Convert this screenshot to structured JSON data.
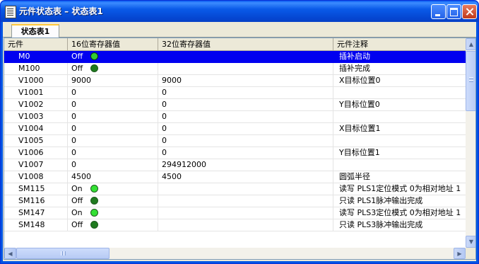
{
  "window": {
    "title": "元件状态表 – 状态表1",
    "buttons": {
      "minimize": "minimize",
      "maximize": "maximize",
      "close": "close"
    }
  },
  "tabs": [
    {
      "label": "状态表1",
      "active": true
    }
  ],
  "table": {
    "columns": [
      "元件",
      "16位寄存器值",
      "32位寄存器值",
      "元件注释"
    ],
    "rows": [
      {
        "name": "M0",
        "v16": "Off",
        "led": "on",
        "v32": "",
        "note": "插补启动",
        "selected": true
      },
      {
        "name": "M100",
        "v16": "Off",
        "led": "off",
        "v32": "",
        "note": "插补完成"
      },
      {
        "name": "V1000",
        "v16": "9000",
        "v32": "9000",
        "note": "X目标位置0"
      },
      {
        "name": "V1001",
        "v16": "0",
        "v32": "0",
        "note": ""
      },
      {
        "name": "V1002",
        "v16": "0",
        "v32": "0",
        "note": "Y目标位置0"
      },
      {
        "name": "V1003",
        "v16": "0",
        "v32": "0",
        "note": ""
      },
      {
        "name": "V1004",
        "v16": "0",
        "v32": "0",
        "note": "X目标位置1"
      },
      {
        "name": "V1005",
        "v16": "0",
        "v32": "0",
        "note": ""
      },
      {
        "name": "V1006",
        "v16": "0",
        "v32": "0",
        "note": "Y目标位置1"
      },
      {
        "name": "V1007",
        "v16": "0",
        "v32": "294912000",
        "note": ""
      },
      {
        "name": "V1008",
        "v16": "4500",
        "v32": "4500",
        "note": "圆弧半径"
      },
      {
        "name": "SM115",
        "v16": "On",
        "led": "on",
        "v32": "",
        "note": "读写 PLS1定位模式 0为相对地址 1"
      },
      {
        "name": "SM116",
        "v16": "Off",
        "led": "off",
        "v32": "",
        "note": "只读 PLS1脉冲输出完成"
      },
      {
        "name": "SM147",
        "v16": "On",
        "led": "on",
        "v32": "",
        "note": "读写 PLS3定位模式 0为相对地址 1"
      },
      {
        "name": "SM148",
        "v16": "Off",
        "led": "off",
        "v32": "",
        "note": "只读 PLS3脉冲输出完成"
      }
    ]
  },
  "scrollbars": {
    "up_glyph": "▲",
    "down_glyph": "▼",
    "left_glyph": "◀",
    "right_glyph": "▶"
  },
  "colors": {
    "selection": "#0000f0",
    "led_on": "#33e033",
    "led_off": "#1f7a1f",
    "titlebar": "#0547d2"
  }
}
